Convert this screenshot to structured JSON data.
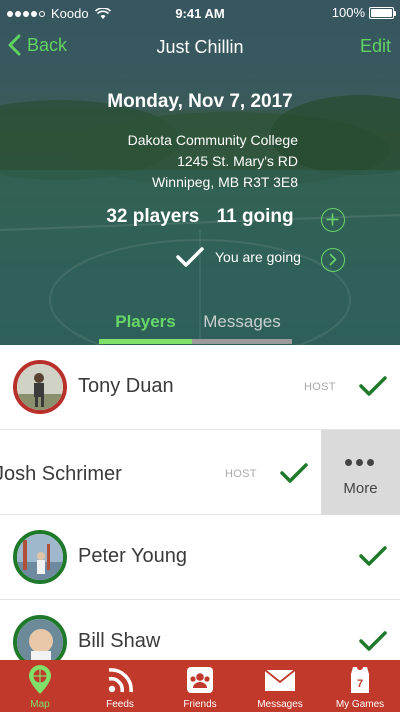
{
  "status_bar": {
    "carrier": "Koodo",
    "time": "9:41 AM",
    "battery": "100%"
  },
  "nav": {
    "back_label": "Back",
    "title": "Just Chillin",
    "edit_label": "Edit"
  },
  "event": {
    "date": "Monday, Nov 7, 2017",
    "address_line1": "Dakota Community College",
    "address_line2": "1245 St. Mary's RD",
    "address_line3": "Winnipeg, MB R3T 3E8",
    "players_count": "32 players",
    "going_count": "11 going",
    "going_status": "You are going"
  },
  "tabs": [
    {
      "label": "Players",
      "active": true
    },
    {
      "label": "Messages",
      "active": false
    }
  ],
  "players": [
    {
      "name": "Tony Duan",
      "role": "HOST",
      "going": true
    },
    {
      "name": "Josh Schrimer",
      "role": "HOST",
      "going": true
    },
    {
      "name": "Peter Young",
      "role": "",
      "going": true
    },
    {
      "name": "Bill Shaw",
      "role": "",
      "going": true
    }
  ],
  "swipe_action": {
    "label": "More"
  },
  "tab_bar": [
    {
      "label": "Map",
      "icon": "map-pin-basketball-icon",
      "active": true
    },
    {
      "label": "Feeds",
      "icon": "rss-icon",
      "active": false
    },
    {
      "label": "Friends",
      "icon": "people-icon",
      "active": false
    },
    {
      "label": "Messages",
      "icon": "envelope-icon",
      "active": false
    },
    {
      "label": "My Games",
      "icon": "jersey-icon",
      "active": false
    }
  ],
  "colors": {
    "accent_green": "#5fd35f",
    "tab_bar_red": "#c0392b",
    "host_ring": "#b8302a",
    "guest_ring": "#1e7a2a",
    "check_green": "#1e7a2a"
  }
}
